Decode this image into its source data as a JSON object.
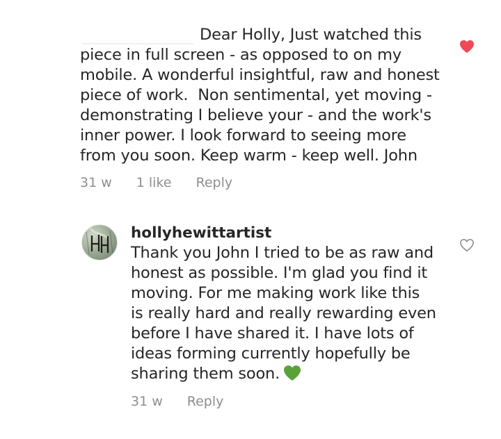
{
  "comment1": {
    "lines": [
      "Dear Holly, Just watched this",
      "piece in full screen - as opposed to on my",
      "mobile. A wonderful insightful, raw and honest",
      "piece of work.  Non sentimental, yet moving -",
      "demonstrating I believe your - and the work's",
      "inner power. I look forward to seeing more",
      "from you soon. Keep warm - keep well. John"
    ],
    "time": "31 w",
    "likes": "1 like",
    "reply": "Reply",
    "liked": true,
    "like_color": "#ed4956",
    "like_icon": "heart-filled-icon"
  },
  "comment2": {
    "username": "hollyhewittartist",
    "avatar_initials": "HH",
    "lines": [
      "Thank you John I tried to be as raw and",
      "honest as possible. I'm glad you find it",
      "moving. For me making work like this",
      "is really hard and really rewarding even",
      "before I have shared it. I have lots of",
      "ideas forming currently hopefully be",
      "sharing them soon."
    ],
    "emoji": "green-heart-emoji",
    "time": "31 w",
    "reply": "Reply",
    "liked": false,
    "like_icon": "heart-outline-icon"
  },
  "colors": {
    "text": "#262626",
    "meta": "#8e8e8e",
    "like_red": "#ed4956",
    "green_heart": "#5aa13a"
  }
}
